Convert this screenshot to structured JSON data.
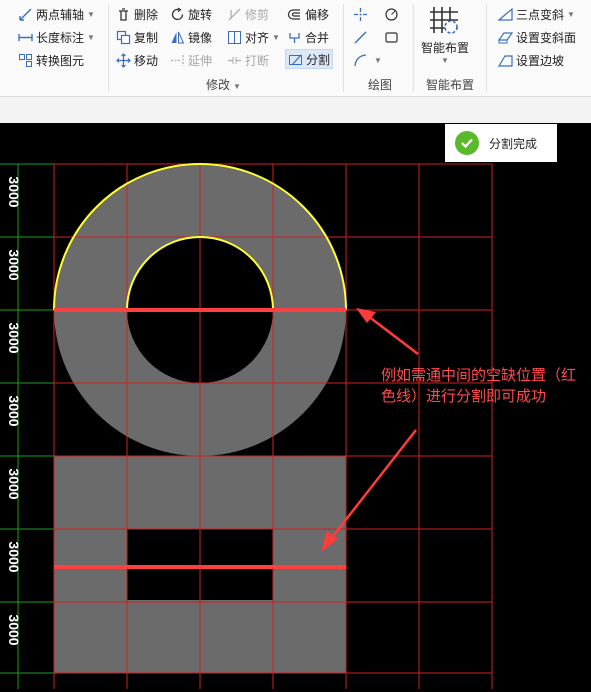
{
  "ribbon": {
    "left": {
      "two_point_axis": "两点辅轴",
      "length_dim": "长度标注",
      "convert_symbol": "转换图元"
    },
    "modify": {
      "label": "修改",
      "delete": "删除",
      "rotate": "旋转",
      "trim": "修剪",
      "offset": "偏移",
      "copy": "复制",
      "mirror": "镜像",
      "align": "对齐",
      "merge": "合并",
      "move": "移动",
      "extend": "延伸",
      "break": "打断",
      "split": "分割"
    },
    "draw": {
      "label": "绘图"
    },
    "smart": {
      "label": "智能布置",
      "button": "智能布置"
    },
    "right": {
      "three_point_slope": "三点变斜",
      "set_slope_face": "设置变斜面",
      "set_slope_edge": "设置边坡"
    }
  },
  "toast": {
    "text": "分割完成",
    "icon": "check-circle-icon"
  },
  "annotation": {
    "text": "例如需通中间的空缺位置（红色线）进行分割即可成功"
  },
  "dimensions": [
    "3000",
    "3000",
    "3000",
    "3000",
    "3000",
    "3000",
    "3000"
  ],
  "colors": {
    "grid": "#d21f1f",
    "axis_green": "#1f9d1f",
    "slab_fill": "#6b6b6b",
    "outline": "#ffff33",
    "split_line": "#ff4040",
    "annotation": "#ff4b4b",
    "toast_ok": "#5aba2a"
  }
}
